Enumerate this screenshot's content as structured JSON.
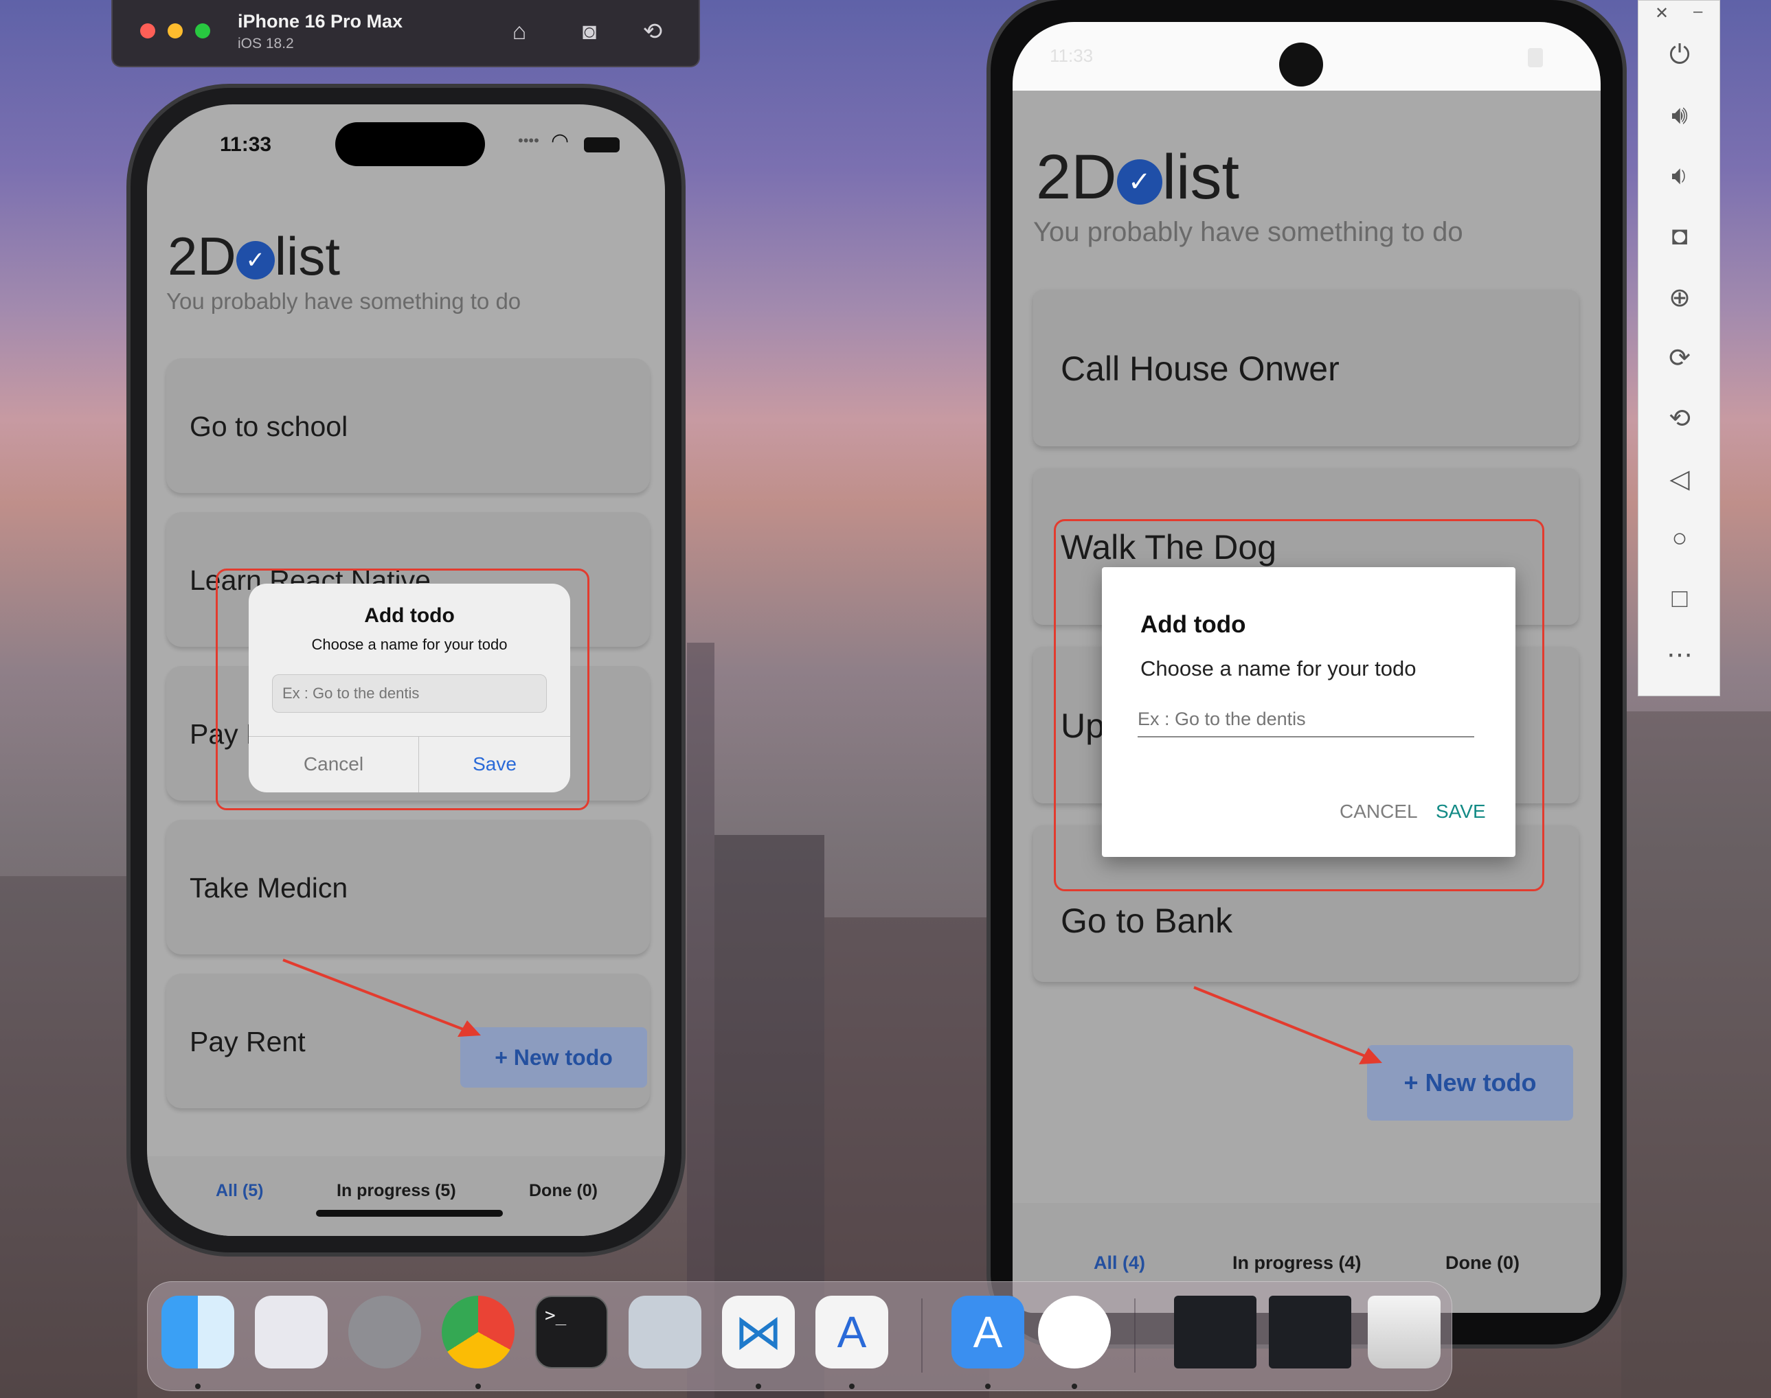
{
  "simulator": {
    "device_name": "iPhone 16 Pro Max",
    "os_version": "iOS 18.2",
    "icons": [
      "home-icon",
      "screenshot-icon",
      "rotate-icon"
    ]
  },
  "ios": {
    "time": "11:33",
    "app_logo_prefix": "2D",
    "app_logo_suffix": "list",
    "subtitle": "You probably have something to do",
    "todos": [
      "Go to school",
      "Learn React Native",
      "Pay E",
      "Take Medicn",
      "Pay Rent"
    ],
    "new_todo_label": "+ New todo",
    "tabs": {
      "all": "All (5)",
      "in_progress": "In progress (5)",
      "done": "Done (0)"
    },
    "dialog": {
      "title": "Add todo",
      "message": "Choose a name for your todo",
      "placeholder": "Ex : Go to the dentis",
      "cancel": "Cancel",
      "save": "Save"
    }
  },
  "android": {
    "time": "11:33",
    "app_logo_prefix": "2D",
    "app_logo_suffix": "list",
    "subtitle": "You probably have something to do",
    "todos": [
      "Call House Onwer",
      "Walk The Dog",
      "Up",
      "Go to Bank"
    ],
    "new_todo_label": "+ New todo",
    "tabs": {
      "all": "All (4)",
      "in_progress": "In progress (4)",
      "done": "Done (0)"
    },
    "dialog": {
      "title": "Add todo",
      "message": "Choose a name for your todo",
      "placeholder": "Ex : Go to the dentis",
      "cancel": "CANCEL",
      "save": "SAVE"
    }
  },
  "emulator_panel": {
    "close_label": "✕",
    "minimize_label": "–",
    "icons": [
      "power-icon",
      "volume-up-icon",
      "volume-down-icon",
      "camera-icon",
      "zoom-icon",
      "rotate-left-icon",
      "rotate-right-icon",
      "back-icon",
      "home-circle-icon",
      "overview-icon",
      "more-icon"
    ]
  },
  "dock": {
    "apps": [
      "finder",
      "launchpad",
      "system-settings",
      "chrome",
      "terminal",
      "system-preferences",
      "vscode",
      "instruments",
      "xcode",
      "android-studio",
      "window-1",
      "window-2",
      "trash"
    ]
  },
  "colors": {
    "accent_blue": "#24509f",
    "annotation_red": "#e33b2e",
    "android_teal": "#128a85"
  }
}
